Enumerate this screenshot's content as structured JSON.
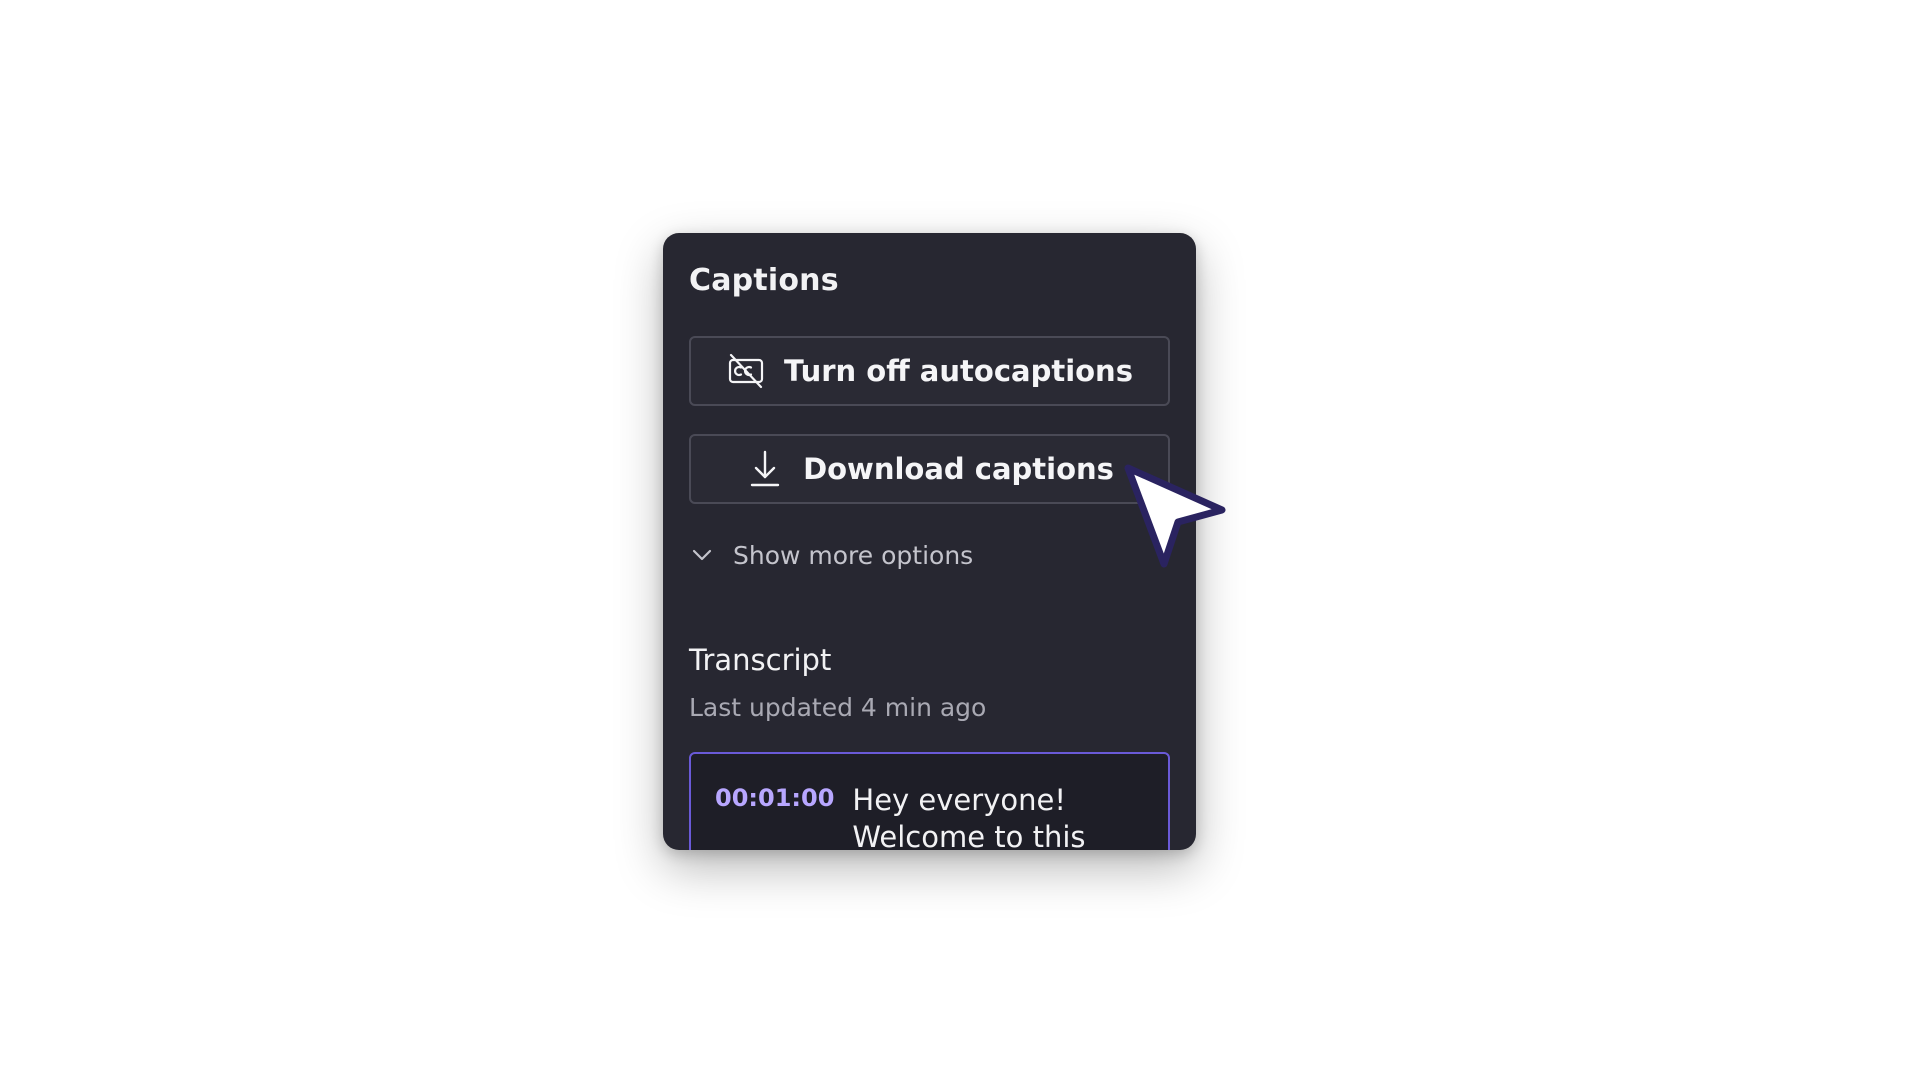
{
  "captions": {
    "title": "Captions",
    "turn_off_label": "Turn off autocaptions",
    "turn_off_icon": "captions-off-icon",
    "download_label": "Download captions",
    "download_icon": "download-icon",
    "more_options_label": "Show more options",
    "more_options_icon": "chevron-down-icon"
  },
  "transcript": {
    "title": "Transcript",
    "last_updated": "Last updated 4 min ago",
    "entries": [
      {
        "time": "00:01:00",
        "text": "Hey everyone! Welcome to this"
      }
    ]
  },
  "colors": {
    "panel_bg": "#272731",
    "accent": "#6a5ad8",
    "timestamp": "#b8a7ff",
    "cursor_outline": "#2a2360"
  }
}
